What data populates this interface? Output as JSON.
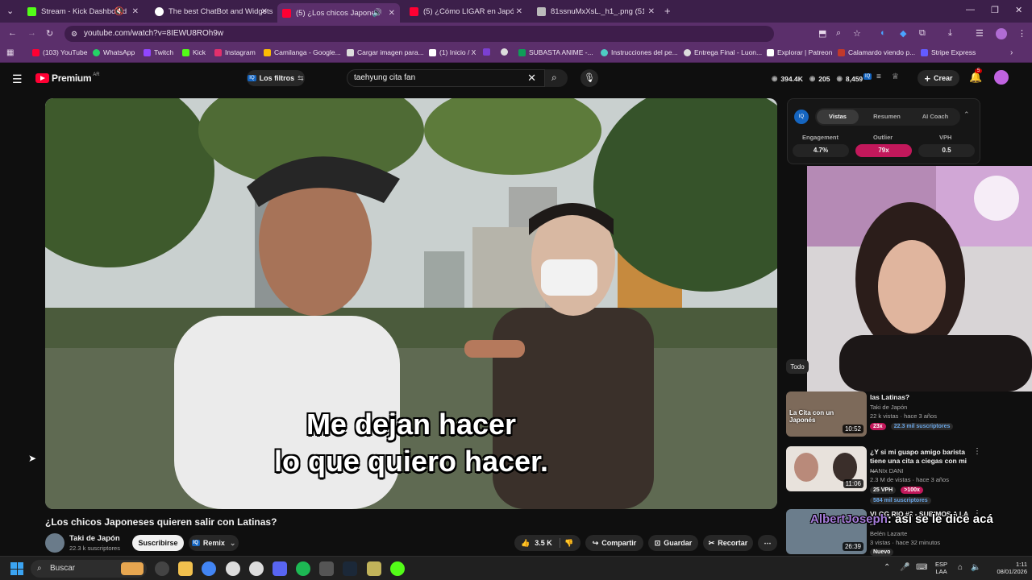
{
  "browser": {
    "tabs": [
      {
        "title": "Stream - Kick Dashboard",
        "favicon_color": "#53fc18"
      },
      {
        "title": "The best ChatBot and Widgets",
        "favicon_color": "#ffffff"
      },
      {
        "title": "(5) ¿Los chicos Japoneses q",
        "favicon_color": "#ff0033"
      },
      {
        "title": "(5) ¿Cómo LIGAR en Japón sien",
        "favicon_color": "#ff0033"
      },
      {
        "title": "81ssnuMxXsL._h1_.png (512×5",
        "favicon_color": "#bbbbbb"
      }
    ],
    "url": "youtube.com/watch?v=8IEWU8ROh9w",
    "bookmarks": [
      {
        "label": "(103) YouTube",
        "color": "#ff0033"
      },
      {
        "label": "WhatsApp",
        "color": "#25d366"
      },
      {
        "label": "Twitch",
        "color": "#9146ff"
      },
      {
        "label": "Kick",
        "color": "#53fc18"
      },
      {
        "label": "Instagram",
        "color": "#e1306c"
      },
      {
        "label": "Camilanga - Google...",
        "color": "#fbbc04"
      },
      {
        "label": "Cargar imagen para...",
        "color": "#dddddd"
      },
      {
        "label": "(1) Inicio / X",
        "color": "#ffffff"
      },
      {
        "label": "",
        "color": "#7b3fd1"
      },
      {
        "label": "",
        "color": "#dddddd"
      },
      {
        "label": "SUBASTA ANIME -...",
        "color": "#0f9d58"
      },
      {
        "label": "Instrucciones del pe...",
        "color": "#4ecdc4"
      },
      {
        "label": "Entrega Final - Luon...",
        "color": "#dddddd"
      },
      {
        "label": "Explorar | Patreon",
        "color": "#ffffff"
      },
      {
        "label": "Calamardo viendo p...",
        "color": "#c0392b"
      },
      {
        "label": "Stripe Express",
        "color": "#635bff"
      }
    ]
  },
  "youtube": {
    "logo_text": "Premium",
    "logo_region": "AR",
    "filters_label": "Los filtros",
    "search_value": "taehyung cita fan",
    "stats": {
      "views": "394.4K",
      "subs": "205",
      "videos": "8,459"
    },
    "create_label": "Crear",
    "notif_count": "5",
    "video": {
      "subtitle_line1": "Me dejan hacer",
      "subtitle_line2": "lo que quiero hacer.",
      "title": "¿Los chicos Japoneses quieren salir con Latinas?",
      "channel": "Taki de Japón",
      "subscribers": "22.3 k suscriptores",
      "subscribe_label": "Suscribirse",
      "remix_label": "Remix",
      "likes": "3.5 K",
      "share_label": "Compartir",
      "save_label": "Guardar",
      "clip_label": "Recortar"
    },
    "panel": {
      "tabs": [
        "Vistas",
        "Resumen",
        "AI Coach"
      ],
      "metrics": [
        {
          "label": "Engagement",
          "value": "4.7%"
        },
        {
          "label": "Outlier",
          "value": "79x"
        },
        {
          "label": "VPH",
          "value": "0.5"
        }
      ]
    },
    "chip_all": "Todo",
    "related": [
      {
        "title": "las Latinas?",
        "channel": "Taki de Japón",
        "meta": "22 k vistas · hace 3 años",
        "badge1": "23x",
        "badge2": "22.3 mil suscriptores",
        "duration": "10:52",
        "thumb_text": "La Cita con un Japonés"
      },
      {
        "title": "¿Y si mi guapo amigo barista tiene una cita a ciegas con mi ...",
        "channel": "NANIx DANI",
        "meta": "2.3 M de vistas · hace 3 años",
        "badge1": "25 VPH",
        "badge2": ">100x",
        "badge3": "584 mil suscriptores",
        "duration": "11:06"
      },
      {
        "title": "VLOG RIO #2 - SUBIMOS A LA ...",
        "channel": "Belén Lazarte",
        "meta": "3 vistas · hace 32 minutos",
        "badge1": "Nuevo",
        "duration": "26:39"
      }
    ],
    "overlay_chat_user": "AlbertJoseph",
    "overlay_chat_text": ": así se le dice acá"
  },
  "taskbar": {
    "search_placeholder": "Buscar",
    "lang": "ESP",
    "lang2": "LAA",
    "time": "1:11",
    "date": "08/01/2026"
  }
}
